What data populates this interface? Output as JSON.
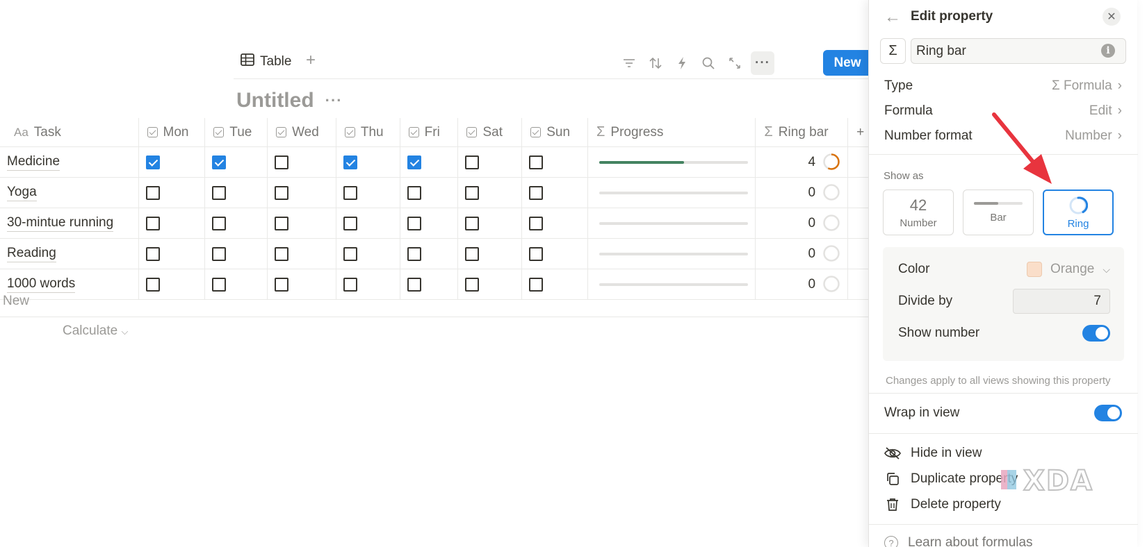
{
  "toolbar": {
    "view_tab_label": "Table",
    "add_view": "+",
    "icons": [
      "filter-icon",
      "sort-icon",
      "automation-icon",
      "search-icon",
      "expand-icon",
      "more-icon"
    ],
    "new_label": "New"
  },
  "database": {
    "title": "Untitled",
    "title_menu": "···"
  },
  "table": {
    "columns": [
      {
        "label": "Task",
        "icon": "Aa"
      },
      {
        "label": "Mon",
        "icon": "checkbox"
      },
      {
        "label": "Tue",
        "icon": "checkbox"
      },
      {
        "label": "Wed",
        "icon": "checkbox"
      },
      {
        "label": "Thu",
        "icon": "checkbox"
      },
      {
        "label": "Fri",
        "icon": "checkbox"
      },
      {
        "label": "Sat",
        "icon": "checkbox"
      },
      {
        "label": "Sun",
        "icon": "checkbox"
      },
      {
        "label": "Progress",
        "icon": "Σ"
      },
      {
        "label": "Ring bar",
        "icon": "Σ"
      }
    ],
    "add_column": "+",
    "rows": [
      {
        "task": "Medicine",
        "days": [
          true,
          true,
          false,
          true,
          true,
          false,
          false
        ],
        "progress": 0.57,
        "ring_value": "4",
        "ring_fraction": 0.57
      },
      {
        "task": "Yoga",
        "days": [
          false,
          false,
          false,
          false,
          false,
          false,
          false
        ],
        "progress": 0,
        "ring_value": "0",
        "ring_fraction": 0
      },
      {
        "task": "30-mintue running",
        "days": [
          false,
          false,
          false,
          false,
          false,
          false,
          false
        ],
        "progress": 0,
        "ring_value": "0",
        "ring_fraction": 0
      },
      {
        "task": "Reading",
        "days": [
          false,
          false,
          false,
          false,
          false,
          false,
          false
        ],
        "progress": 0,
        "ring_value": "0",
        "ring_fraction": 0
      },
      {
        "task": "1000 words",
        "days": [
          false,
          false,
          false,
          false,
          false,
          false,
          false
        ],
        "progress": 0,
        "ring_value": "0",
        "ring_fraction": 0
      }
    ],
    "new_row": "New",
    "calculate": "Calculate"
  },
  "colors": {
    "accent": "#2383e2",
    "progress_fill": "#448361",
    "ring_orange": "#d9730d",
    "ring_track": "#e3e2e0",
    "arrow_red": "#e8343e"
  },
  "panel": {
    "title": "Edit property",
    "back_icon": "←",
    "close_icon": "✕",
    "sigma": "Σ",
    "name_value": "Ring bar",
    "info_icon": "i",
    "type_label": "Type",
    "type_value": "Σ Formula",
    "formula_label": "Formula",
    "formula_value": "Edit",
    "number_format_label": "Number format",
    "number_format_value": "Number",
    "chevron": "›",
    "show_as_label": "Show as",
    "show_as_options": [
      {
        "big": "42",
        "label": "Number"
      },
      {
        "label": "Bar"
      },
      {
        "label": "Ring"
      }
    ],
    "selected_option": "Ring",
    "color_label": "Color",
    "color_value": "Orange",
    "divide_by_label": "Divide by",
    "divide_by_value": "7",
    "show_number_label": "Show number",
    "show_number_on": true,
    "note": "Changes apply to all views showing this property",
    "wrap_label": "Wrap in view",
    "wrap_on": true,
    "hide_label": "Hide in view",
    "duplicate_label": "Duplicate property",
    "delete_label": "Delete property",
    "learn_label": "Learn about formulas"
  },
  "watermark": {
    "text": "XDA"
  }
}
